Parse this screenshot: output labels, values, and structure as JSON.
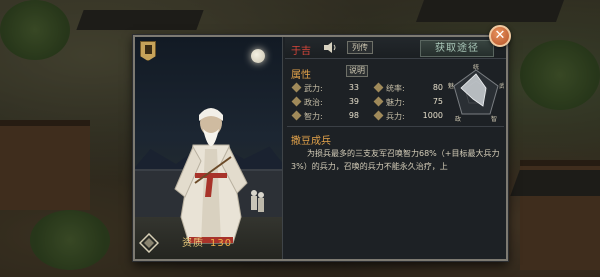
{
  "hero": {
    "name": "于吉",
    "bio_label": "列传",
    "aptitude_label": "资质",
    "aptitude_value": "130"
  },
  "actions": {
    "obtain_label": "获取途径",
    "close_label": "✕"
  },
  "attributes": {
    "title": "属性",
    "explain_label": "说明",
    "stats": [
      {
        "label": "武力:",
        "value": "33",
        "icon": "sword-icon"
      },
      {
        "label": "统率:",
        "value": "80",
        "icon": "banner-icon"
      },
      {
        "label": "政治:",
        "value": "39",
        "icon": "scroll-icon"
      },
      {
        "label": "魅力:",
        "value": "75",
        "icon": "charm-icon"
      },
      {
        "label": "智力:",
        "value": "98",
        "icon": "brain-icon"
      },
      {
        "label": "兵力:",
        "value": "1000",
        "icon": "troops-icon"
      }
    ],
    "radar_labels": [
      "统",
      "武",
      "智",
      "政",
      "魅"
    ]
  },
  "skill": {
    "title": "撒豆成兵",
    "description": "为损兵最多的三支友军召唤智力68%（+目标最大兵力3%）的兵力，召唤的兵力不能永久治疗，上"
  },
  "colors": {
    "name": "#d8463a",
    "section_title": "#e2a24a",
    "aptitude_value": "#f0b24a",
    "close_button": "#c86a3e"
  }
}
